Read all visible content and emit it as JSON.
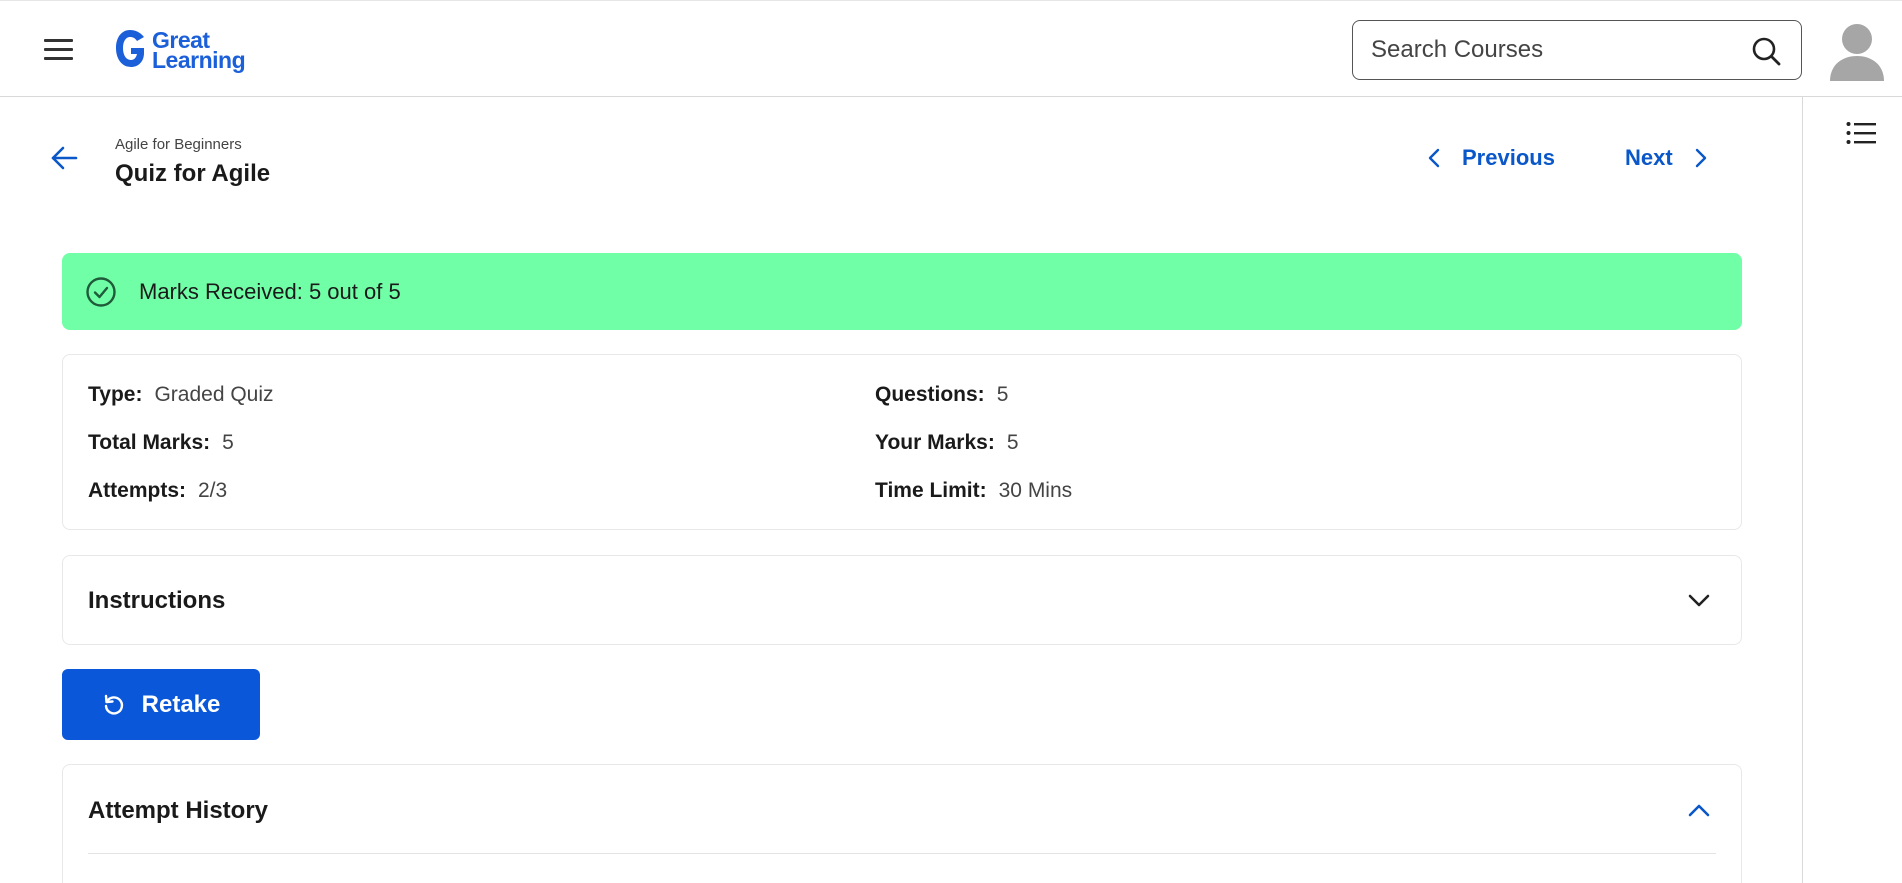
{
  "header": {
    "logo_line1": "Great",
    "logo_line2": "Learning",
    "search_placeholder": "Search Courses"
  },
  "title_area": {
    "breadcrumb": "Agile for Beginners",
    "title": "Quiz for Agile",
    "previous_label": "Previous",
    "next_label": "Next"
  },
  "banner": {
    "text": "Marks Received: 5 out of 5",
    "color": "#70ffa6"
  },
  "details": {
    "type_label": "Type:",
    "type_value": "Graded Quiz",
    "questions_label": "Questions:",
    "questions_value": "5",
    "total_marks_label": "Total Marks:",
    "total_marks_value": "5",
    "your_marks_label": "Your Marks:",
    "your_marks_value": "5",
    "attempts_label": "Attempts:",
    "attempts_value": "2/3",
    "time_limit_label": "Time Limit:",
    "time_limit_value": "30 Mins"
  },
  "instructions": {
    "title": "Instructions"
  },
  "retake": {
    "label": "Retake"
  },
  "attempt_history": {
    "title": "Attempt History"
  },
  "colors": {
    "brand_blue": "#0a57d9",
    "link_blue": "#0a57c9",
    "success_green": "#70ffa6"
  },
  "icons": {
    "menu": "hamburger-menu-icon",
    "search": "search-icon",
    "avatar": "user-avatar-icon",
    "toc": "list-icon",
    "back": "arrow-left-icon",
    "check": "check-circle-icon",
    "retake": "refresh-icon"
  }
}
